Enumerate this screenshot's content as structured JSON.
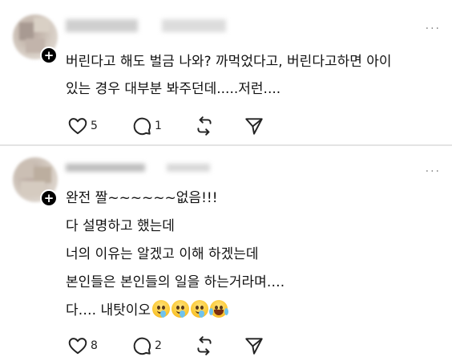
{
  "posts": [
    {
      "more_label": "···",
      "lines": [
        "버린다고 해도 벌금 나와? 까먹었다고, 버린다고하면 아이",
        "있는 경우 대부분 봐주던데.....저런...."
      ],
      "likes": "5",
      "comments": "1"
    },
    {
      "more_label": "···",
      "lines": [
        "완전 짤~~~~~~없음!!!",
        "다 설명하고 했는데",
        "너의 이유는 알겠고 이해 하겠는데",
        "본인들은 본인들의 일을 하는거라며….",
        "다…. 내탓이오"
      ],
      "emojis": [
        "drooling-face-emoji",
        "drooling-face-emoji",
        "drooling-face-emoji",
        "tears-of-joy-emoji"
      ],
      "likes": "8",
      "comments": "2"
    }
  ],
  "icons": {
    "plus": "+",
    "like": "heart-icon",
    "comment": "comment-bubble-icon",
    "repost": "repost-icon",
    "share": "send-icon"
  }
}
